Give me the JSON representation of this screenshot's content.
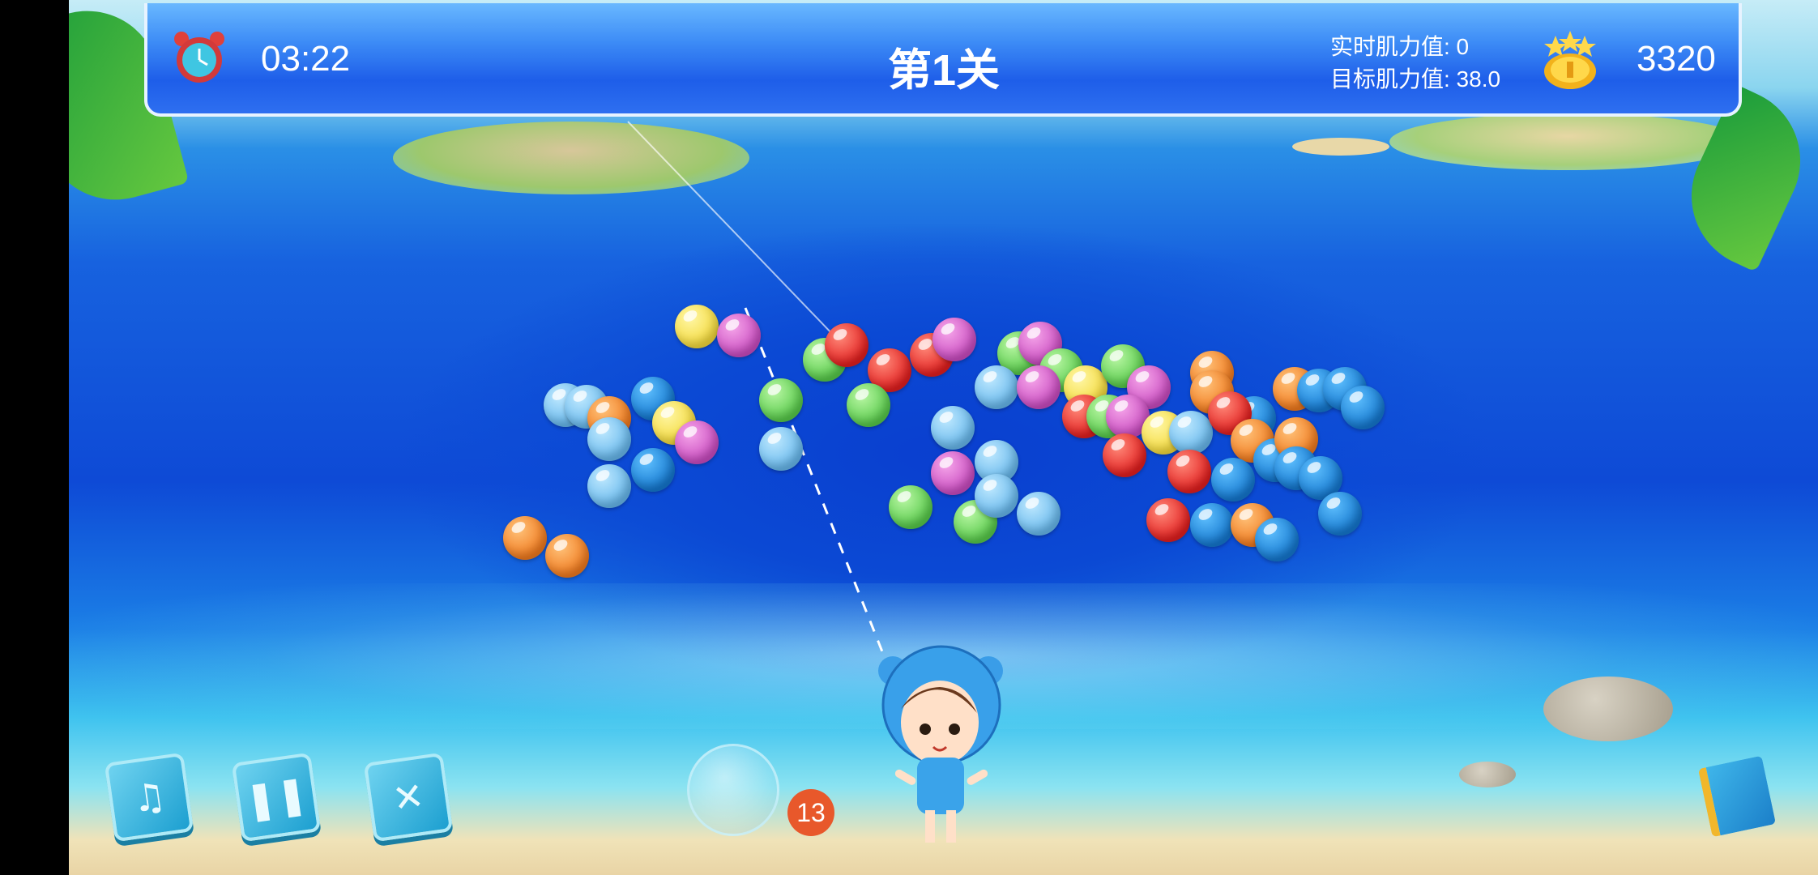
{
  "header": {
    "timer": "03:22",
    "level_title": "第1关",
    "realtime_strength": "实时肌力值: 0",
    "target_strength": "目标肌力值: 38.0",
    "score": "3320"
  },
  "launcher": {
    "shots_remaining": "13"
  },
  "controls": {
    "music_icon": "music-note-icon",
    "pause_icon": "pause-icon",
    "close_icon": "close-icon",
    "guide_icon": "book-icon"
  },
  "colors": {
    "header_blue": "#1e5ee9",
    "badge_orange": "#e8582b"
  }
}
